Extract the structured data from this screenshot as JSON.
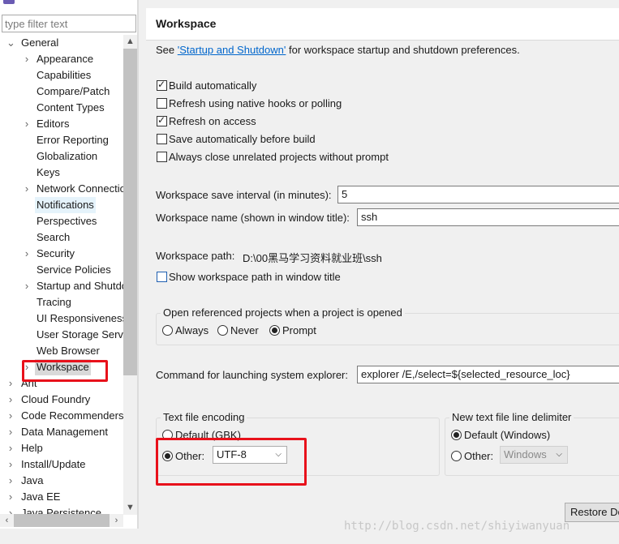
{
  "filter": {
    "placeholder": "type filter text"
  },
  "tree": {
    "items": [
      {
        "label": "General",
        "expanded": true
      },
      {
        "label": "Appearance",
        "has_children": true
      },
      {
        "label": "Capabilities"
      },
      {
        "label": "Compare/Patch"
      },
      {
        "label": "Content Types"
      },
      {
        "label": "Editors",
        "has_children": true
      },
      {
        "label": "Error Reporting"
      },
      {
        "label": "Globalization"
      },
      {
        "label": "Keys"
      },
      {
        "label": "Network Connections",
        "has_children": true
      },
      {
        "label": "Notifications"
      },
      {
        "label": "Perspectives"
      },
      {
        "label": "Search"
      },
      {
        "label": "Security",
        "has_children": true
      },
      {
        "label": "Service Policies"
      },
      {
        "label": "Startup and Shutdown",
        "has_children": true
      },
      {
        "label": "Tracing"
      },
      {
        "label": "UI Responsiveness"
      },
      {
        "label": "User Storage Service"
      },
      {
        "label": "Web Browser"
      },
      {
        "label": "Workspace",
        "has_children": true,
        "selected": true
      },
      {
        "label": "Ant",
        "has_children": true
      },
      {
        "label": "Cloud Foundry",
        "has_children": true
      },
      {
        "label": "Code Recommenders",
        "has_children": true
      },
      {
        "label": "Data Management",
        "has_children": true
      },
      {
        "label": "Help",
        "has_children": true
      },
      {
        "label": "Install/Update",
        "has_children": true
      },
      {
        "label": "Java",
        "has_children": true
      },
      {
        "label": "Java EE",
        "has_children": true
      },
      {
        "label": "Java Persistence",
        "has_children": true
      }
    ]
  },
  "page": {
    "title": "Workspace",
    "see_prefix": "See ",
    "see_link": "'Startup and Shutdown'",
    "see_suffix": " for workspace startup and shutdown preferences.",
    "checkboxes": [
      {
        "label": "Build automatically",
        "checked": true
      },
      {
        "label": "Refresh using native hooks or polling",
        "checked": false
      },
      {
        "label": "Refresh on access",
        "checked": true
      },
      {
        "label": "Save automatically before build",
        "checked": false
      },
      {
        "label": "Always close unrelated projects without prompt",
        "checked": false
      }
    ],
    "save_interval_label": "Workspace save interval (in minutes):",
    "save_interval_value": "5",
    "workspace_name_label": "Workspace name (shown in window title):",
    "workspace_name_value": "ssh",
    "workspace_path_label": "Workspace path:",
    "workspace_path_value": "D:\\00黑马学习资料就业班\\ssh",
    "show_path_label": "Show workspace path in window title",
    "open_projects": {
      "label": "Open referenced projects when a project is opened",
      "options": [
        "Always",
        "Never",
        "Prompt"
      ],
      "selected": "Prompt"
    },
    "explorer_label": "Command for launching system explorer:",
    "explorer_value": "explorer /E,/select=${selected_resource_loc}",
    "encoding": {
      "label": "Text file encoding",
      "default_label": "Default (GBK)",
      "other_label": "Other:",
      "other_value": "UTF-8",
      "selected": "Other"
    },
    "delimiter": {
      "label": "New text file line delimiter",
      "default_label": "Default (Windows)",
      "other_label": "Other:",
      "other_value": "Windows",
      "selected": "Default"
    },
    "restore_button": "Restore De"
  },
  "watermark": "http://blog.csdn.net/shiyiwanyuan",
  "colors": {
    "highlight_red": "#e8111b",
    "link_blue": "#0066cc"
  }
}
